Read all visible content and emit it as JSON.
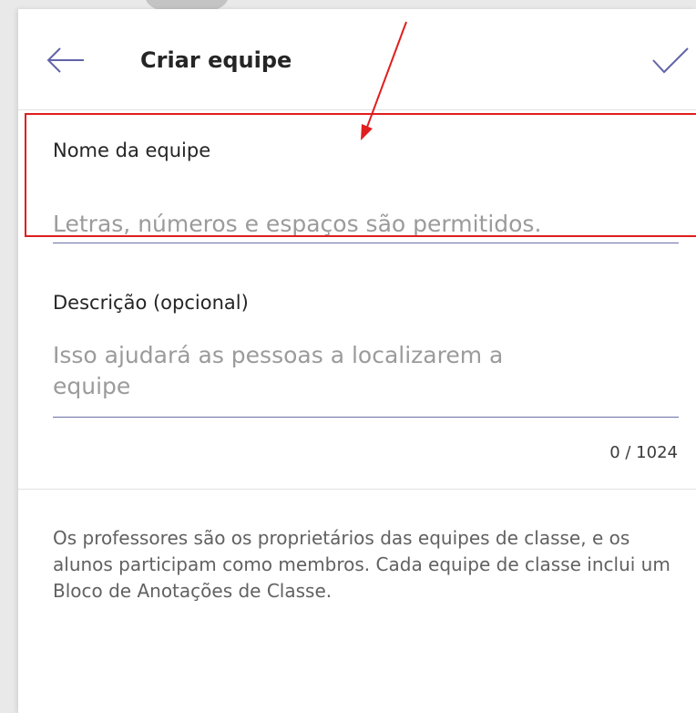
{
  "header": {
    "title": "Criar equipe",
    "back_icon": "arrow-left-icon",
    "confirm_icon": "checkmark-icon"
  },
  "form": {
    "team_name": {
      "label": "Nome da equipe",
      "value": "",
      "placeholder": "Letras, números e espaços são permitidos."
    },
    "description": {
      "label": "Descrição (opcional)",
      "value": "",
      "placeholder_line1": "Isso ajudará as pessoas a localizarem a",
      "placeholder_line2": "equipe",
      "counter": "0 / 1024"
    }
  },
  "info_text": "Os professores são os proprietários das equipes de classe, e os alunos participam como membros. Cada equipe de classe inclui um Bloco de Anotações de Classe.",
  "colors": {
    "accent": "#6264a7",
    "annotation": "#e01e1e",
    "placeholder": "#9b9b9b"
  }
}
